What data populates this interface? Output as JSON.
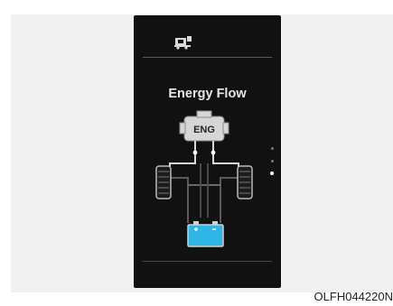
{
  "screen": {
    "title": "Energy Flow",
    "engine_label": "ENG",
    "page_indicator": {
      "count": 3,
      "active_index": 2
    },
    "icons": {
      "top_left": "vehicle-info-icon"
    },
    "colors": {
      "background": "#111111",
      "battery": "#2fb6e6",
      "flow_lines": "#d8d8d8"
    }
  },
  "caption": "OLFH044220N"
}
